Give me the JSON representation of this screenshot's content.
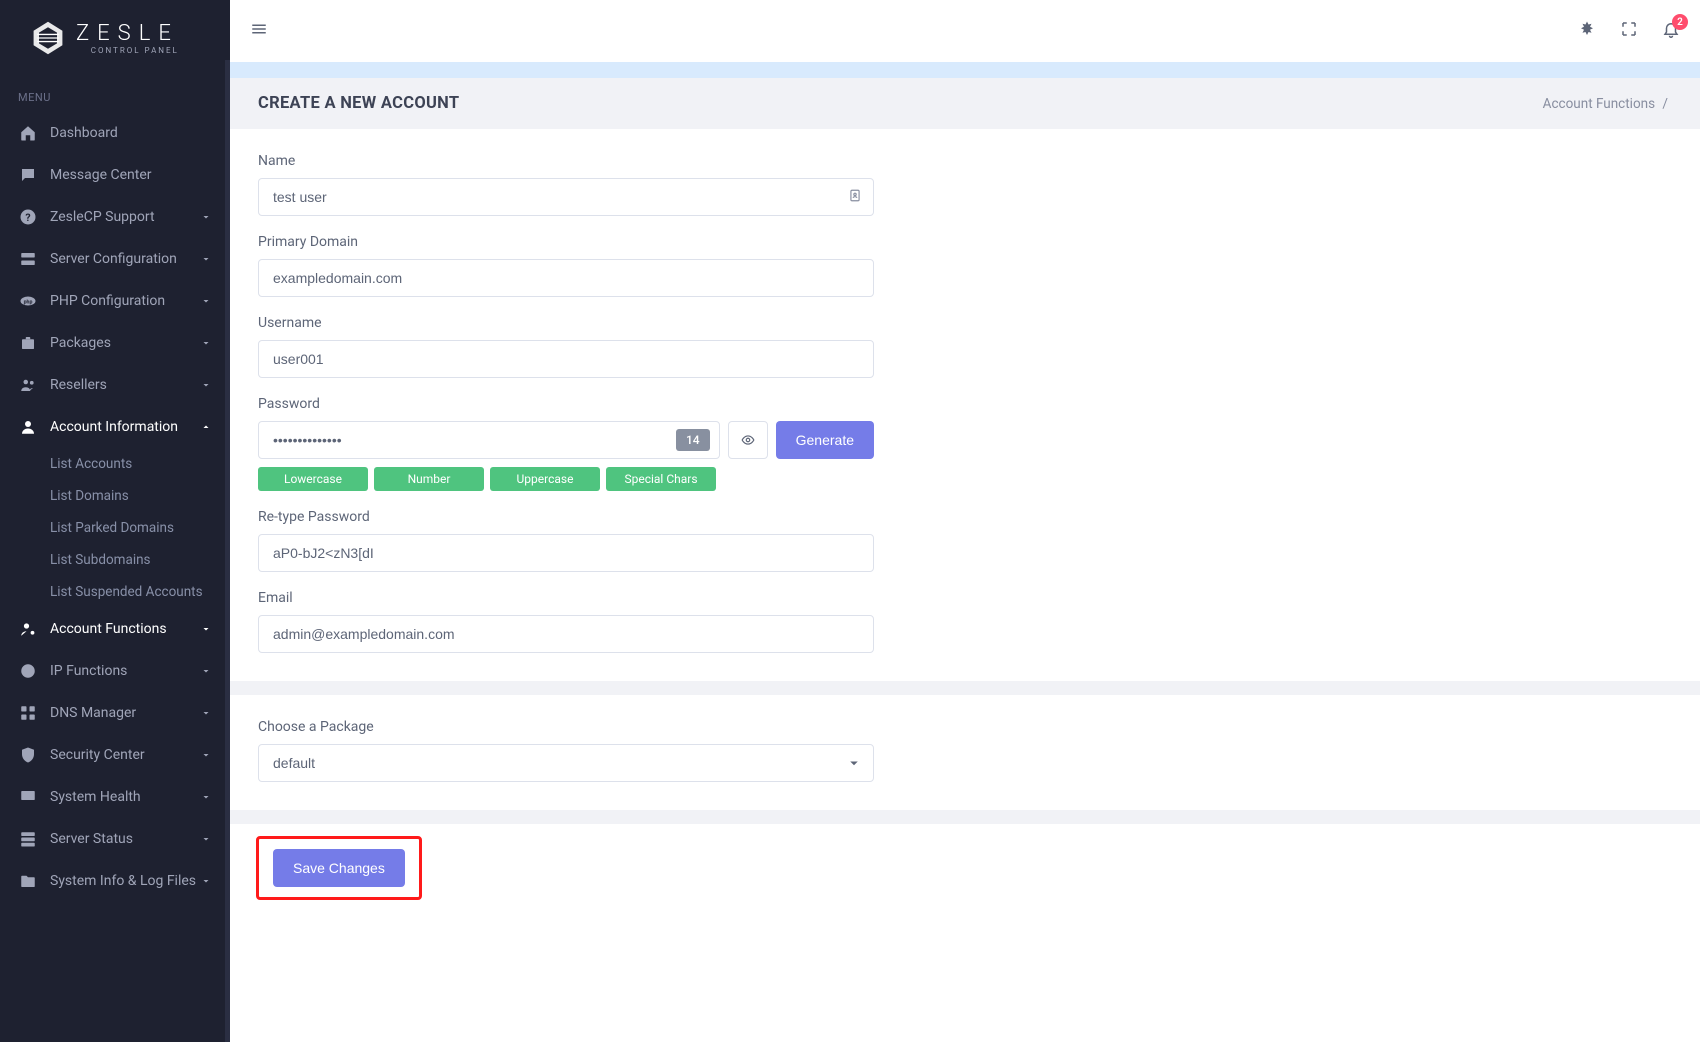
{
  "brand": {
    "name": "ZESLE",
    "sub": "CONTROL PANEL"
  },
  "menuLabel": "MENU",
  "sidebar": [
    {
      "label": "Dashboard",
      "icon": "home",
      "expand": false
    },
    {
      "label": "Message Center",
      "icon": "chat",
      "expand": false
    },
    {
      "label": "ZesleCP Support",
      "icon": "help",
      "expand": true
    },
    {
      "label": "Server Configuration",
      "icon": "server",
      "expand": true
    },
    {
      "label": "PHP Configuration",
      "icon": "php",
      "expand": true
    },
    {
      "label": "Packages",
      "icon": "package",
      "expand": true
    },
    {
      "label": "Resellers",
      "icon": "users",
      "expand": true
    },
    {
      "label": "Account Information",
      "icon": "user",
      "expand": true,
      "open": true,
      "children": [
        "List Accounts",
        "List Domains",
        "List Parked Domains",
        "List Subdomains",
        "List Suspended Accounts"
      ]
    },
    {
      "label": "Account Functions",
      "icon": "usercog",
      "expand": true,
      "active": true
    },
    {
      "label": "IP Functions",
      "icon": "globe",
      "expand": true
    },
    {
      "label": "DNS Manager",
      "icon": "dns",
      "expand": true
    },
    {
      "label": "Security Center",
      "icon": "shield",
      "expand": true
    },
    {
      "label": "System Health",
      "icon": "monitor",
      "expand": true
    },
    {
      "label": "Server Status",
      "icon": "server2",
      "expand": true
    },
    {
      "label": "System Info & Log Files",
      "icon": "folder",
      "expand": true
    }
  ],
  "topbar": {
    "badge": "2"
  },
  "page": {
    "title": "CREATE A NEW ACCOUNT"
  },
  "breadcrumb": {
    "item": "Account Functions",
    "sep": "/"
  },
  "form": {
    "name": {
      "label": "Name",
      "value": "test user"
    },
    "domain": {
      "label": "Primary Domain",
      "value": "exampledomain.com"
    },
    "username": {
      "label": "Username",
      "value": "user001"
    },
    "password": {
      "label": "Password",
      "value": "••••••••••••••",
      "count": "14",
      "generate": "Generate",
      "tags": [
        "Lowercase",
        "Number",
        "Uppercase",
        "Special Chars"
      ]
    },
    "repassword": {
      "label": "Re-type Password",
      "value": "aP0-bJ2<zN3[dI"
    },
    "email": {
      "label": "Email",
      "value": "admin@exampledomain.com"
    },
    "package": {
      "label": "Choose a Package",
      "value": "default"
    }
  },
  "save": "Save Changes"
}
